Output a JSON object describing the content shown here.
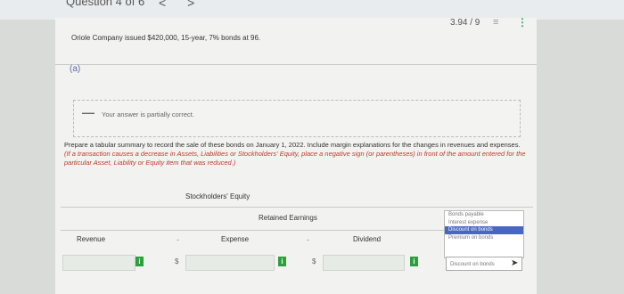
{
  "header": {
    "question_nav": "Question 4 of 6",
    "prev": "<",
    "next": ">",
    "score": "3.94 / 9",
    "menu_icon": "list-icon",
    "more_icon": "more-icon"
  },
  "question": {
    "text": "Oriole Company issued $420,000, 15-year, 7% bonds at 96.",
    "part": "(a)"
  },
  "feedback": {
    "text": "Your answer is partially correct."
  },
  "prompt": {
    "main": "Prepare a tabular summary to record the sale of these bonds on January 1, 2022. Include margin explanations for the changes in revenues and expenses.",
    "instruction": "(If a transaction causes a decrease in Assets, Liabilities or Stockholders' Equity, place a negative sign (or parentheses) in front of the amount entered for the particular Asset, Liability or Equity item that was reduced.)"
  },
  "table": {
    "stockholders_equity": "Stockholders' Equity",
    "retained_earnings": "Retained Earnings",
    "columns": [
      "Revenue",
      "Expense",
      "Dividend"
    ],
    "operators": [
      "-",
      "-"
    ],
    "dollar": "$",
    "info_label": "i"
  },
  "dropdown": {
    "options": [
      "Bonds payable",
      "Interest expense",
      "Discount on bonds",
      "Premium on bonds"
    ],
    "selected_index": 2,
    "selected_value": "Discount on bonds"
  }
}
